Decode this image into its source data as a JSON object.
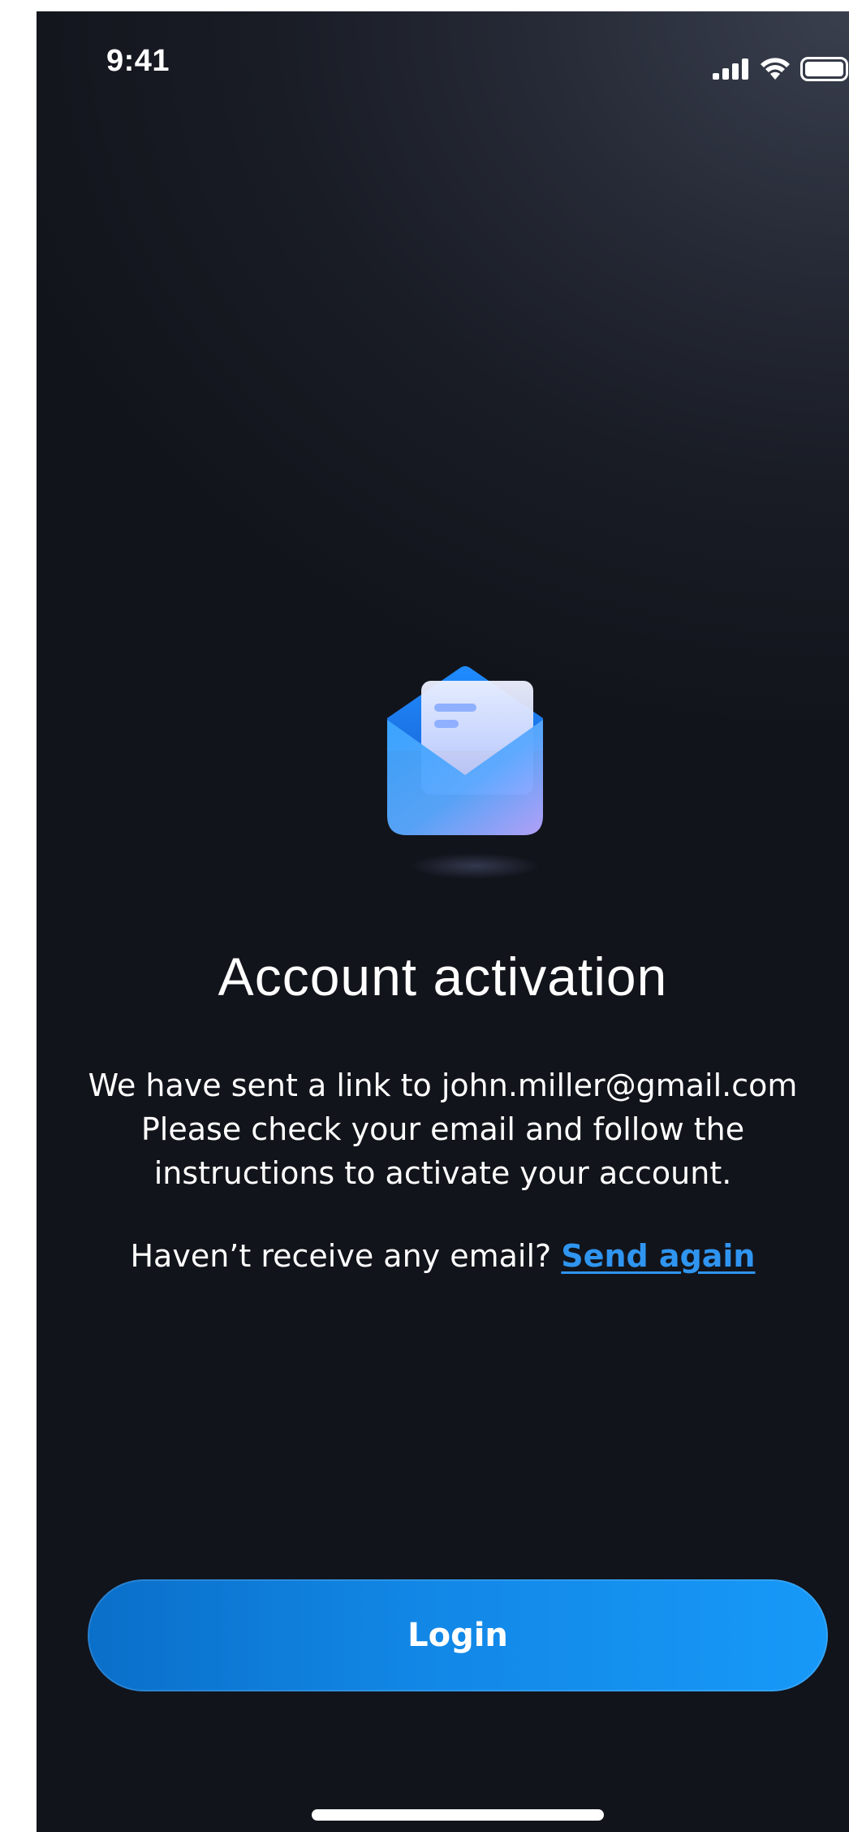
{
  "status_bar": {
    "time": "9:41",
    "icons": [
      "signal-icon",
      "wifi-icon",
      "battery-icon"
    ]
  },
  "illustration": {
    "icon": "open-envelope-icon"
  },
  "content": {
    "title": "Account activation",
    "message_line1": "We have sent a link to john.miller@gmail.com",
    "message_line2": "Please check your email and follow the",
    "message_line3": "instructions to activate your account.",
    "resend_prompt": "Haven’t receive any email?",
    "resend_link": "Send again"
  },
  "actions": {
    "login_label": "Login"
  },
  "colors": {
    "background_top": "#3a3f4e",
    "background_bottom": "#12141b",
    "accent": "#1799f8",
    "link": "#2f95f0",
    "text": "#ffffff"
  }
}
